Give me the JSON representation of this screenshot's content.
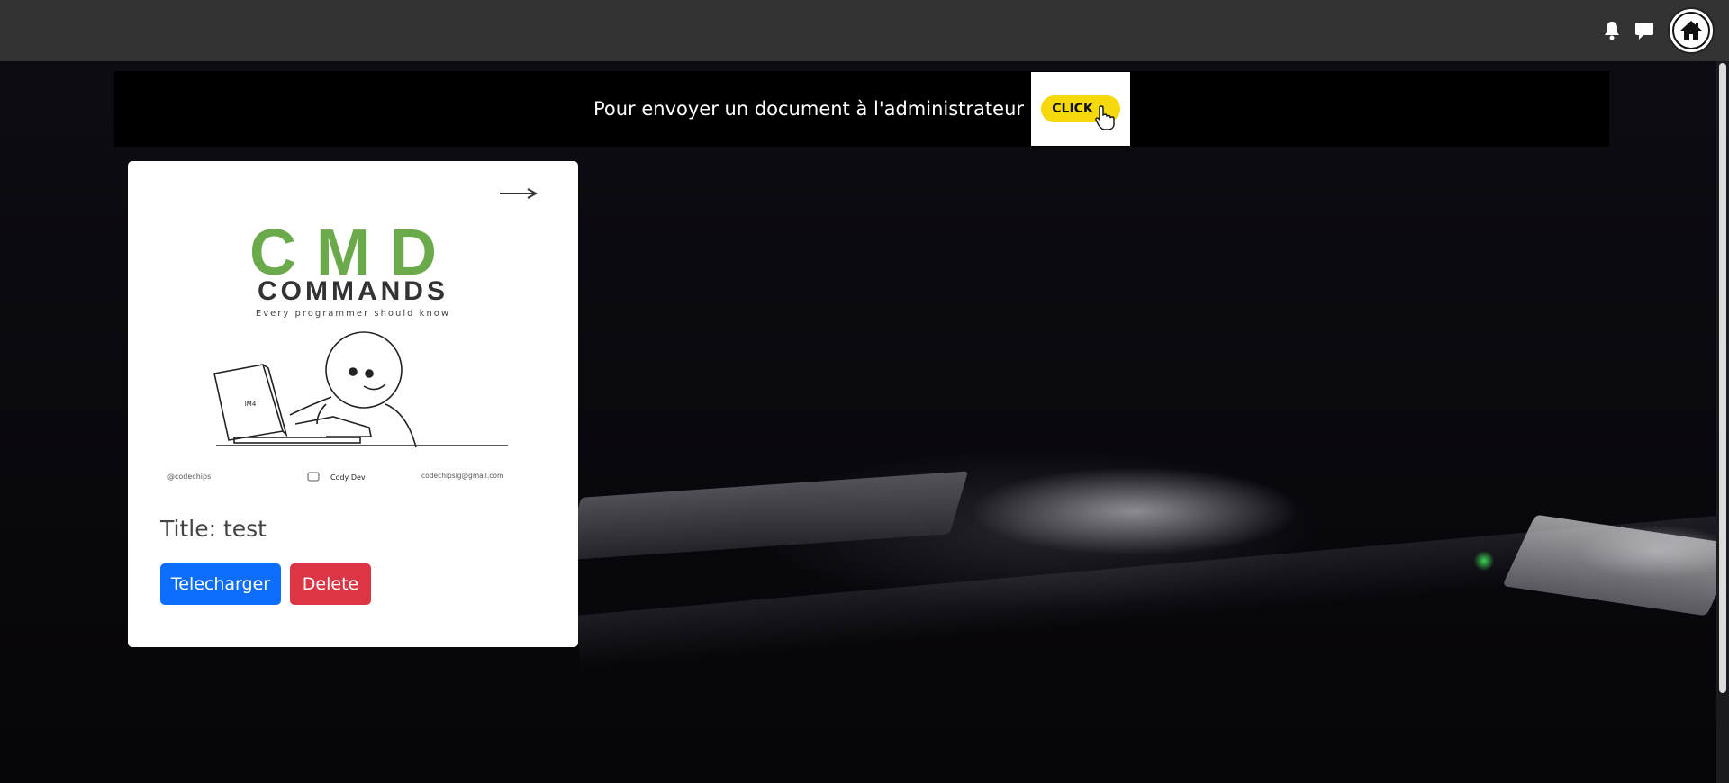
{
  "topbar": {
    "icons": [
      "bell-icon",
      "chat-icon",
      "home-icon"
    ]
  },
  "notice": {
    "text": "Pour envoyer un document à l'administrateur",
    "click_label": "CLICK",
    "click_color": "#f5d90a"
  },
  "document": {
    "cover": {
      "title_big": "CMD",
      "title_sub": "COMMANDS",
      "tagline": "Every programmer should know",
      "handle": "@codechips",
      "channel": "Cody Dev",
      "email": "codechipsig@gmail.com",
      "laptop_text": "IM4"
    },
    "title": "Title: test",
    "download_label": "Telecharger",
    "delete_label": "Delete"
  },
  "colors": {
    "topbar": "#333333",
    "download": "#0d6efd",
    "delete": "#dc3545",
    "cmd_green": "#6aaa4a"
  }
}
